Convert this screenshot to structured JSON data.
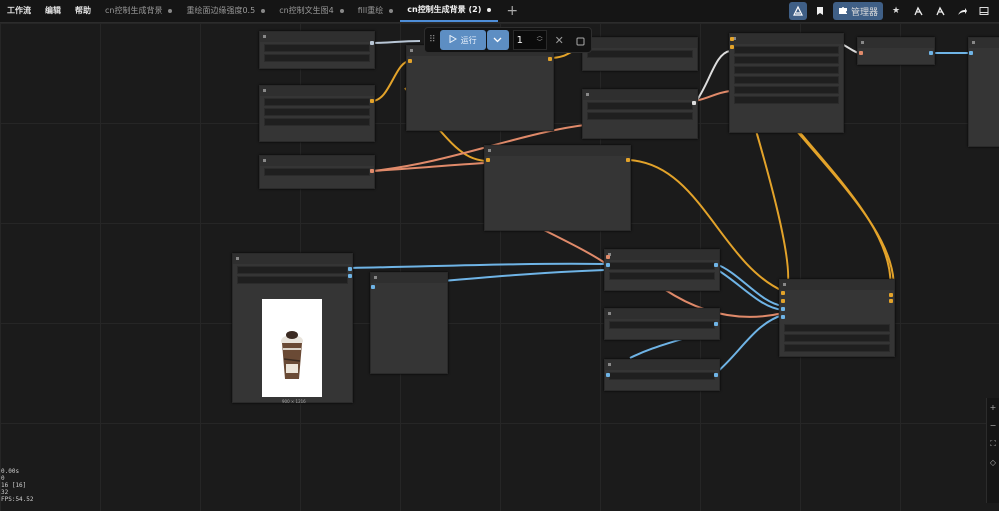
{
  "menu": [
    {
      "label": "工作流"
    },
    {
      "label": "编辑"
    },
    {
      "label": "帮助"
    }
  ],
  "tabs": [
    {
      "label": "cn控制生成背景",
      "active": false
    },
    {
      "label": "重绘面边缘强度0.5",
      "active": false
    },
    {
      "label": "cn控制文生图4",
      "active": false
    },
    {
      "label": "fill重绘",
      "active": false
    },
    {
      "label": "cn控制生成背景 (2)",
      "active": true
    }
  ],
  "toolbar": {
    "manager_label": "管理器",
    "icons": [
      "comfy-logo-icon",
      "bookmark-icon",
      "puzzle-icon",
      "star-icon",
      "brand-icon",
      "brand-icon-2",
      "share-icon",
      "panel-toggle-icon"
    ]
  },
  "run": {
    "label": "运行",
    "count": "1"
  },
  "image_node": {
    "caption": "900 × 1216"
  },
  "stats": {
    "lines": [
      "0.00s",
      "0",
      "16 [16]",
      "32",
      "FPS:54.52"
    ]
  },
  "colors": {
    "link_model": "#e3a32a",
    "link_clip": "#e08a6a",
    "link_image": "#6fb4e6",
    "accent": "#5d8ec3"
  }
}
